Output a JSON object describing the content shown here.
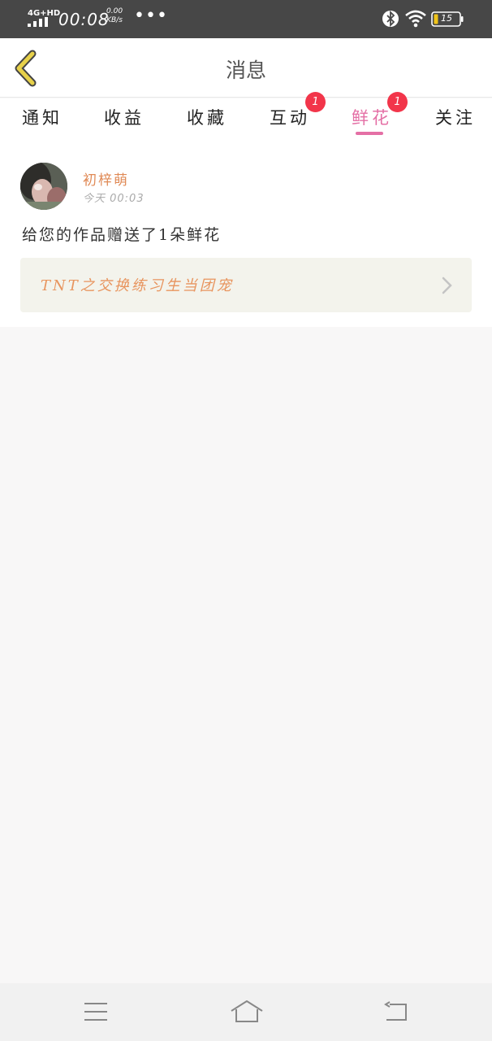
{
  "status_bar": {
    "network": "4G+HD",
    "time": "00:08",
    "speed_value": "0.00",
    "speed_unit": "KB/s",
    "more": "•••",
    "battery": "15"
  },
  "header": {
    "title": "消息"
  },
  "tabs": [
    {
      "label": "通知",
      "active": false,
      "badge": ""
    },
    {
      "label": "收益",
      "active": false,
      "badge": ""
    },
    {
      "label": "收藏",
      "active": false,
      "badge": ""
    },
    {
      "label": "互动",
      "active": false,
      "badge": "1"
    },
    {
      "label": "鲜花",
      "active": true,
      "badge": "1"
    },
    {
      "label": "关注",
      "active": false,
      "badge": ""
    }
  ],
  "notification": {
    "username": "初梓萌",
    "time": "今天  00:03",
    "message": "给您的作品赠送了1朵鲜花",
    "work_title": "TNT之交换练习生当团宠"
  },
  "colors": {
    "accent": "#e46fa5",
    "badge": "#f2354a",
    "username": "#e08a56",
    "back_icon": "#e7d14a",
    "battery": "#f0c419"
  }
}
